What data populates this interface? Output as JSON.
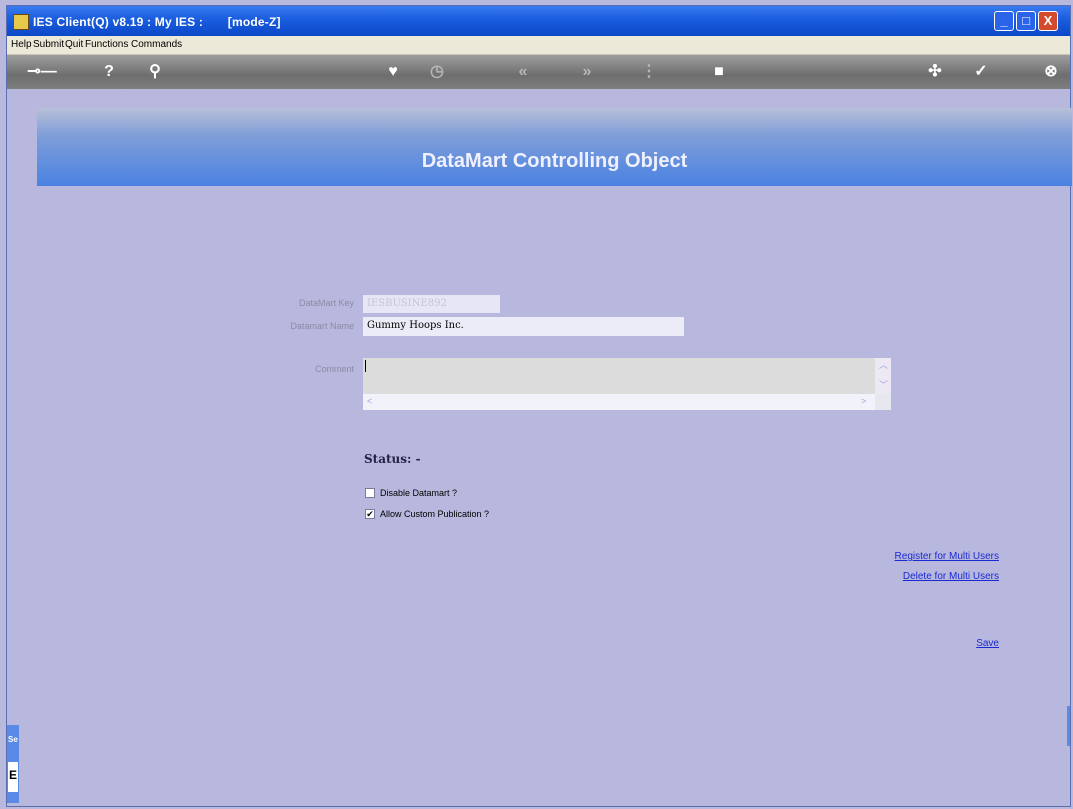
{
  "window": {
    "title": "IES Client(Q) v8.19 : My IES :       [mode-Z]",
    "min": "_",
    "max": "□",
    "close": "X"
  },
  "menu": [
    "Help",
    "Submit",
    "Quit",
    "Functions",
    "Commands"
  ],
  "toolbar": {
    "icons": [
      "key-icon",
      "help-icon",
      "search-icon",
      "heart-icon",
      "clock-icon",
      "back-icon",
      "forward-icon",
      "list-icon",
      "stop-icon",
      "tools-icon",
      "ok-icon",
      "close-icon"
    ]
  },
  "banner": {
    "title": "DataMart Controlling Object"
  },
  "form": {
    "datamart_key_label": "DataMart Key",
    "datamart_key_value": "IESBUSINE892",
    "datamart_name_label": "Datamart Name",
    "datamart_name_value": "Gummy Hoops Inc.",
    "comment_label": "Comment",
    "comment_value": ""
  },
  "status": {
    "label": "Status: -"
  },
  "checkboxes": [
    {
      "label": "Disable Datamart ?",
      "checked": false
    },
    {
      "label": "Allow Custom Publication ?",
      "checked": true
    }
  ],
  "links": {
    "register": "Register for Multi Users",
    "delete": "Delete for Multi Users",
    "save": "Save"
  },
  "sidebar": {
    "tab1": "Se",
    "tab2": "E"
  }
}
